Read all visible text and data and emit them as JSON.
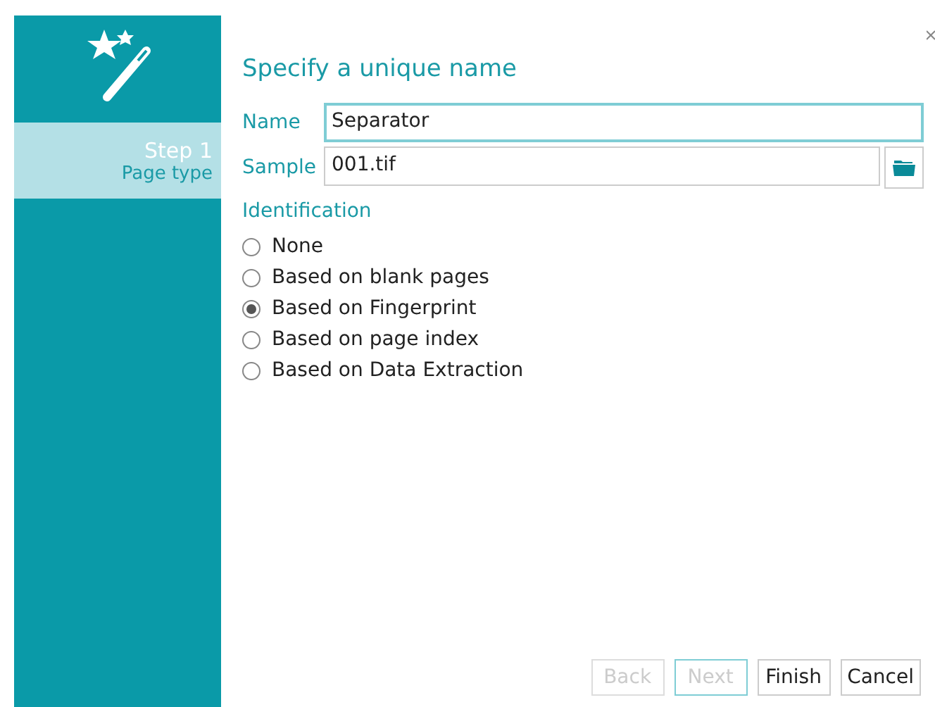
{
  "sidebar": {
    "steps": [
      {
        "label": "Step 1",
        "sublabel": "Page type",
        "selected": true
      }
    ]
  },
  "heading": "Specify a unique name",
  "fields": [
    {
      "kind": "text",
      "label": "Name",
      "value": "Separator",
      "focused": true
    },
    {
      "kind": "file",
      "label": "Sample",
      "value": "001.tif",
      "focused": false
    }
  ],
  "identification": {
    "title": "Identification",
    "options": [
      {
        "label": "None",
        "selected": false
      },
      {
        "label": "Based on blank pages",
        "selected": false
      },
      {
        "label": "Based on Fingerprint",
        "selected": true
      },
      {
        "label": "Based on page index",
        "selected": false
      },
      {
        "label": "Based on Data Extraction",
        "selected": false
      }
    ]
  },
  "buttons": [
    {
      "label": "Back",
      "disabled": true,
      "focused": false
    },
    {
      "label": "Next",
      "disabled": true,
      "focused": true
    },
    {
      "label": "Finish",
      "disabled": false,
      "focused": false
    },
    {
      "label": "Cancel",
      "disabled": false,
      "focused": false
    }
  ]
}
